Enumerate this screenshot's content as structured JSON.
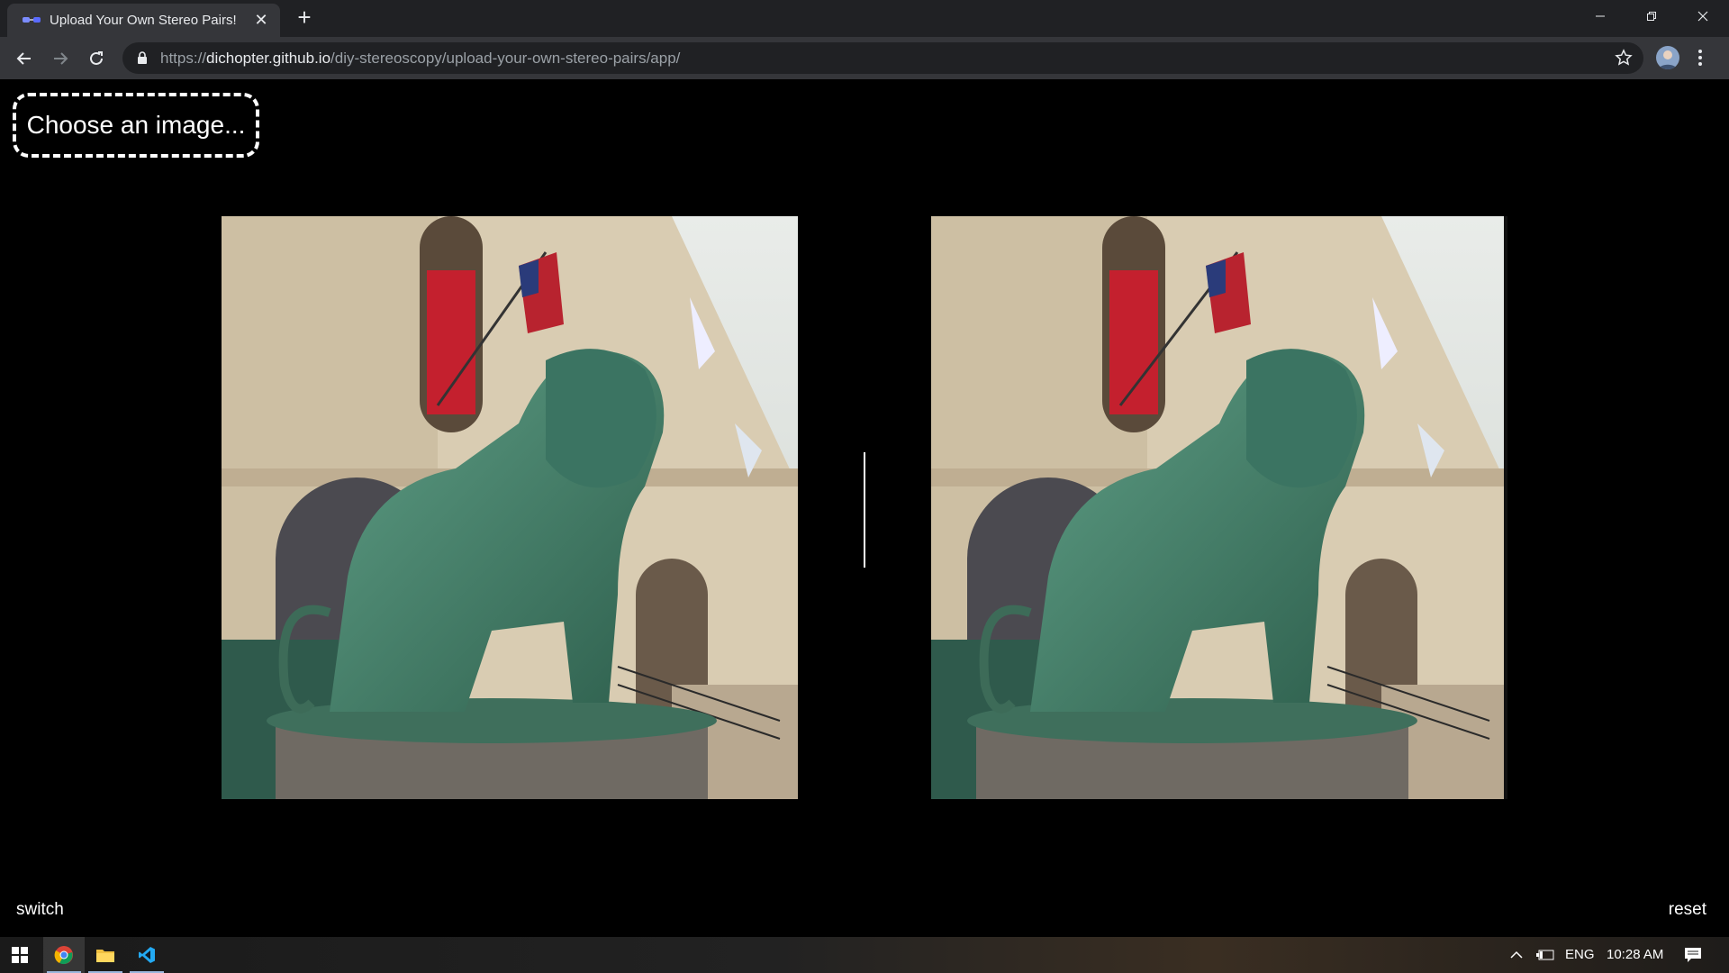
{
  "browser": {
    "tab_title": "Upload Your Own Stereo Pairs!",
    "tab_close": "✕",
    "new_tab": "+",
    "url_prefix": "https://",
    "url_host": "dichopter.github.io",
    "url_path": "/diy-stereoscopy/upload-your-own-stereo-pairs/app/"
  },
  "page": {
    "choose_label": "Choose an image...",
    "switch_label": "switch",
    "reset_label": "reset",
    "left_image_alt": "Lion statue at Art Institute of Chicago (left eye)",
    "right_image_alt": "Lion statue at Art Institute of Chicago (right eye)"
  },
  "taskbar": {
    "language": "ENG",
    "clock": "10:28 AM"
  },
  "colors": {
    "page_background": "#000000",
    "tab_background": "#35363a",
    "titlebar": "#202124"
  }
}
